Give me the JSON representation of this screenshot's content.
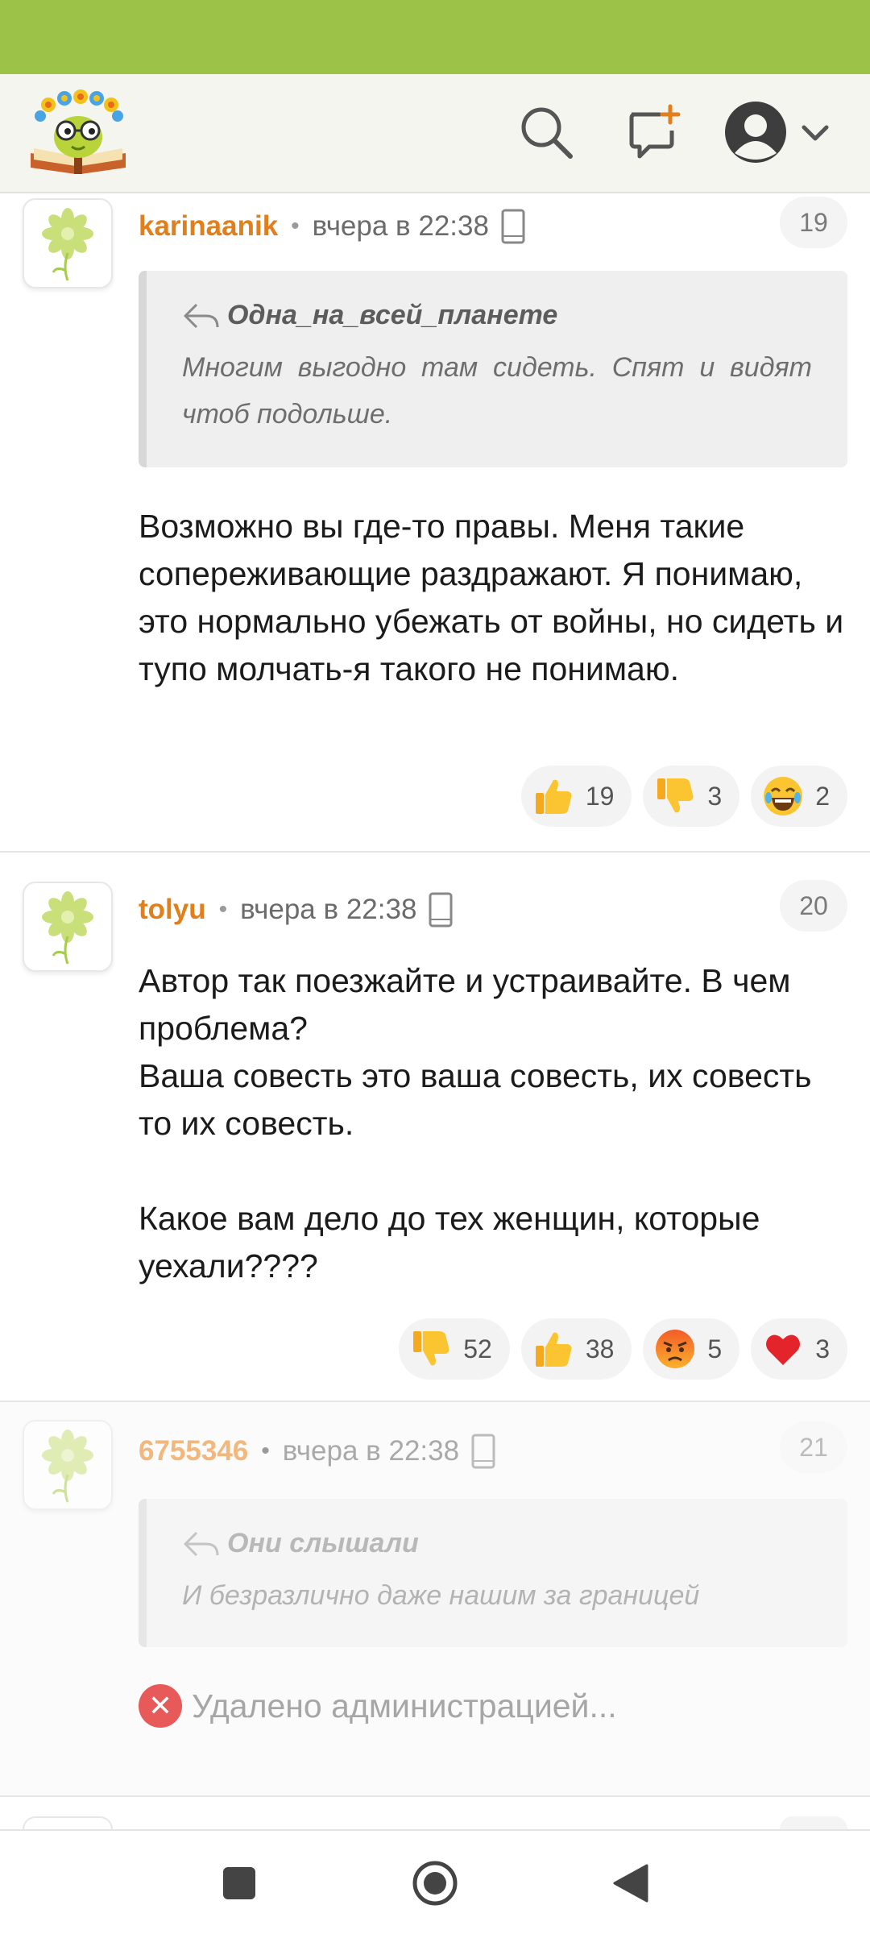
{
  "colors": {
    "status_bar": "#9cc247",
    "author": "#e07f1b",
    "delete_icon": "#e85a5a"
  },
  "header": {
    "logo_icon": "reader-logo",
    "search_icon": "search-icon",
    "new_post_icon": "new-post-icon",
    "profile_icon": "user-avatar-icon",
    "menu_icon": "chevron-down-icon"
  },
  "comments": [
    {
      "author": "karinaanik",
      "time": "вчера в 22:38",
      "device": "phone-icon",
      "number": "19",
      "quote": {
        "author": "Одна_на_всей_планете",
        "text": "Многим выгодно там сидеть. Спят и видят чтоб подольше."
      },
      "text": "Возможно вы где-то правы. Меня такие сопереживающие раздражают. Я понимаю, это нормально убежать от войны, но сидеть и тупо молчать-я такого не понимаю.",
      "reactions": [
        {
          "icon": "thumbs-up",
          "count": "19"
        },
        {
          "icon": "thumbs-down",
          "count": "3"
        },
        {
          "icon": "laughing-face",
          "count": "2"
        }
      ]
    },
    {
      "author": "tolyu",
      "time": "вчера в 22:38",
      "device": "phone-icon",
      "number": "20",
      "text": "Автор так поезжайте и устраивайте. В чем проблема?\nВаша совесть это ваша совесть, их совесть то их совесть.\n\nКакое вам дело до тех женщин, которые уехали????",
      "reactions": [
        {
          "icon": "thumbs-down",
          "count": "52"
        },
        {
          "icon": "thumbs-up",
          "count": "38"
        },
        {
          "icon": "angry-face",
          "count": "5"
        },
        {
          "icon": "red-heart",
          "count": "3"
        }
      ]
    },
    {
      "author": "6755346",
      "time": "вчера в 22:38",
      "device": "phone-icon",
      "number": "21",
      "quote": {
        "author": "Они слышали",
        "text": "И безразлично даже нашим за границей"
      },
      "deleted_text": "Удалено администрацией..."
    }
  ],
  "navbar": {
    "recents_icon": "square-icon",
    "home_icon": "circle-icon",
    "back_icon": "triangle-back-icon"
  }
}
